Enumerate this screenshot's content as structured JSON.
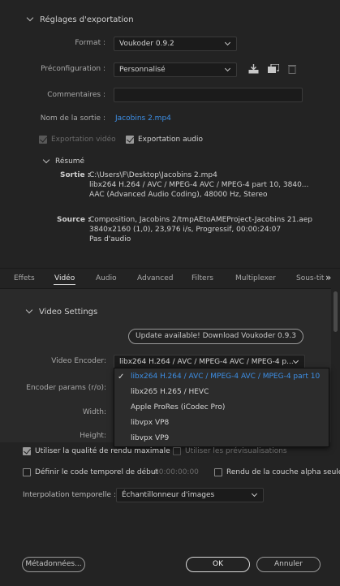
{
  "export_settings": {
    "title": "Réglages d'exportation",
    "format": {
      "label": "Format :",
      "value": "Voukoder 0.9.2"
    },
    "preset": {
      "label": "Préconfiguration :",
      "value": "Personnalisé"
    },
    "comments": {
      "label": "Commentaires :",
      "value": ""
    },
    "output_name": {
      "label": "Nom de la sortie :",
      "value": "Jacobins 2.mp4"
    },
    "export_video": {
      "label": "Exportation vidéo",
      "checked": true,
      "disabled": true
    },
    "export_audio": {
      "label": "Exportation audio",
      "checked": true
    }
  },
  "summary": {
    "title": "Résumé",
    "output_label": "Sortie :",
    "output_lines": [
      "C:\\Users\\F\\Desktop\\Jacobins 2.mp4",
      "libx264 H.264 / AVC / MPEG-4 AVC / MPEG-4 part 10, 3840...",
      "AAC (Advanced Audio Coding), 48000 Hz, Stereo"
    ],
    "source_label": "Source :",
    "source_lines": [
      "Composition, Jacobins 2/tmpAEtoAMEProject-Jacobins 21.aep",
      "3840x2160 (1,0), 23,976 i/s, Progressif, 00:00:24:07",
      "Pas d'audio"
    ]
  },
  "tabs": [
    {
      "label": "Effets",
      "active": false
    },
    {
      "label": "Vidéo",
      "active": true
    },
    {
      "label": "Audio",
      "active": false
    },
    {
      "label": "Advanced",
      "active": false
    },
    {
      "label": "Filters",
      "active": false
    },
    {
      "label": "Multiplexer",
      "active": false
    },
    {
      "label": "Sous-tit",
      "active": false
    }
  ],
  "tabs_more": "»",
  "video_settings": {
    "title": "Video Settings",
    "update_button": "Update available! Download Voukoder 0.9.3",
    "encoder_label": "Video Encoder:",
    "encoder_value": "libx264 H.264 / AVC / MPEG-4 AVC / MPEG-4 p...",
    "encoder_params_label": "Encoder params (r/o):",
    "width_label": "Width:",
    "height_label": "Height:"
  },
  "encoder_menu": [
    {
      "label": "libx264 H.264 / AVC / MPEG-4 AVC / MPEG-4 part 10",
      "selected": true
    },
    {
      "label": "libx265 H.265 / HEVC",
      "selected": false
    },
    {
      "label": "Apple ProRes (iCodec Pro)",
      "selected": false
    },
    {
      "label": "libvpx VP8",
      "selected": false
    },
    {
      "label": "libvpx VP9",
      "selected": false
    }
  ],
  "bottom": {
    "max_render_quality": {
      "label": "Utiliser la qualité de rendu maximale",
      "checked": true
    },
    "use_previews": {
      "label": "Utiliser les prévisualisations",
      "checked": false,
      "disabled": true
    },
    "start_timecode": {
      "label": "Définir le code temporel de début",
      "value": "00:00:00:00",
      "checked": false
    },
    "alpha_render": {
      "label": "Rendu de la couche alpha seule",
      "checked": false
    },
    "time_interp": {
      "label": "Interpolation temporelle :",
      "value": "Échantillonneur d'images"
    }
  },
  "buttons": {
    "metadata": "Métadonnées...",
    "ok": "OK",
    "cancel": "Annuler"
  },
  "colors": {
    "accent": "#3d8fe6",
    "background": "#232323"
  }
}
